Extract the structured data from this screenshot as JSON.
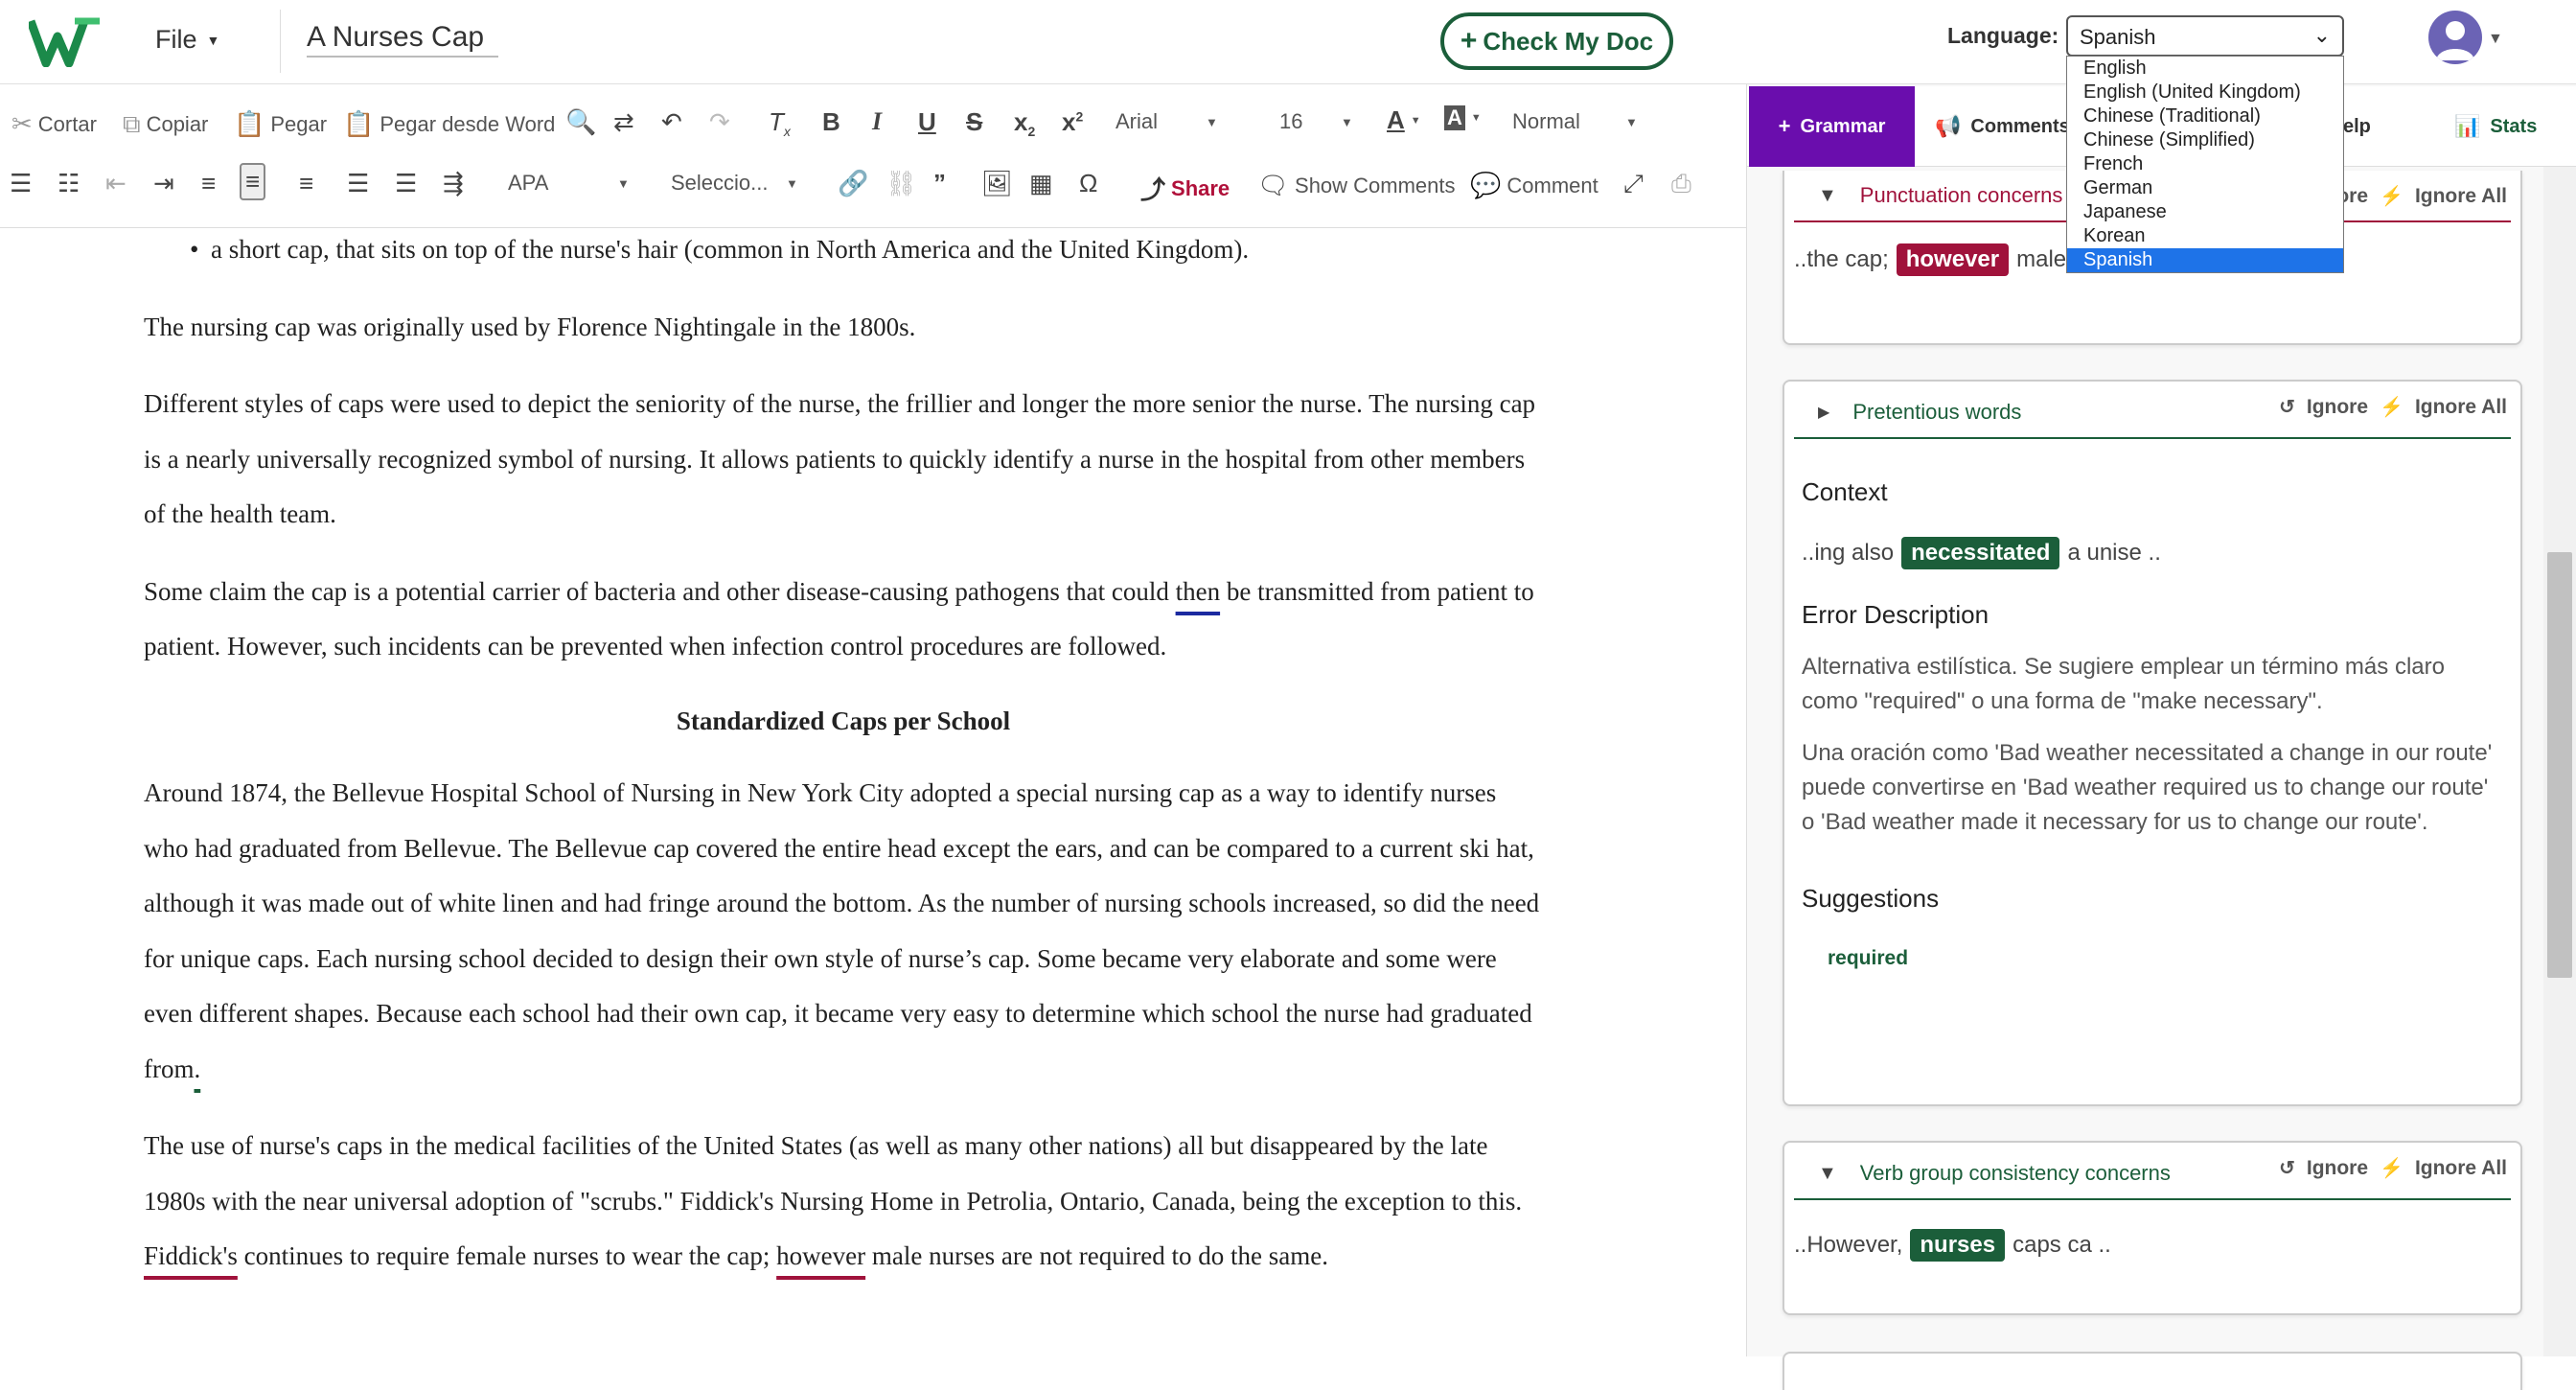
{
  "app": {
    "file_menu": "File",
    "doc_title": "A Nurses Cap",
    "check_button": "Check My Doc",
    "language_label": "Language:",
    "language_selected": "Spanish",
    "language_options": [
      "English",
      "English (United Kingdom)",
      "Chinese (Traditional)",
      "Chinese (Simplified)",
      "French",
      "German",
      "Japanese",
      "Korean",
      "Spanish"
    ]
  },
  "toolbar": {
    "cut": "Cortar",
    "copy": "Copiar",
    "paste": "Pegar",
    "paste_word": "Pegar desde Word",
    "font": "Arial",
    "size": "16",
    "style": "Normal",
    "citation": "APA",
    "select": "Seleccio...",
    "share": "Share",
    "show_comments": "Show Comments",
    "comment": "Comment"
  },
  "document": {
    "bullet": "a short cap, that sits on top of the nurse's hair (common in North America and the United Kingdom).",
    "p1": "The nursing cap was originally used by Florence Nightingale in the 1800s.",
    "p2": "Different styles of caps were used to depict the seniority of the nurse, the frillier and longer the more senior the nurse. The nursing cap is a nearly universally recognized symbol of nursing. It allows patients to quickly identify a nurse in the hospital from other members of the health team.",
    "p3_a": "Some claim the cap is a potential carrier of bacteria and other disease-causing pathogens that could ",
    "p3_flag": "then",
    "p3_b": " be transmitted from patient to patient. However, such incidents can be prevented when infection control procedures are followed.",
    "heading": "Standardized Caps per School",
    "p4_a": "Around 1874, the Bellevue Hospital School of Nursing in New York City adopted a special nursing cap as a way to identify nurses who had graduated from Bellevue. The Bellevue cap covered the entire head except the ears, and can be compared to a current ski hat, although it was made out of white linen and had fringe around the bottom. As the number of nursing schools increased, so did the need for unique caps. Each nursing school decided to design their own style of nurse’s cap. Some became very elaborate and some were even different shapes. Because each school had their own cap, it became very easy to determine which school the nurse had graduated from",
    "p4_flag": ".",
    "p5_a": "The use of nurse's caps in the medical facilities of the United States (as well as many other nations) all but disappeared by the late 1980s with the near universal adoption of \"scrubs.\" Fiddick's Nursing Home in Petrolia, Ontario, Canada, being the exception to this. ",
    "p5_flag1": "Fiddick's",
    "p5_b": " continues to require female nurses to wear the cap; ",
    "p5_flag2": "however",
    "p5_c": " male nurses are not required to do the same."
  },
  "sidebar": {
    "tab_grammar": "Grammar",
    "tab_comments": "Comments",
    "tab_help": "elp",
    "tab_stats": "Stats",
    "ignore": "Ignore",
    "ignore_all": "Ignore All",
    "card1": {
      "title": "Punctuation concerns",
      "ignore_partial": "ore",
      "ctx_before": "..the cap;",
      "ctx_word": "however",
      "ctx_after": "male nu ..",
      "color": "#a0123b"
    },
    "card2": {
      "title": "Pretentious words",
      "context_label": "Context",
      "ctx_before": "..ing also",
      "ctx_word": "necessitated",
      "ctx_after": "a unise ..",
      "error_label": "Error Description",
      "desc1": "Alternativa estilística. Se sugiere emplear un término más claro como \"required\" o una forma de \"make necessary\".",
      "desc2": "Una oración como 'Bad weather necessitated a change in our route' puede convertirse en 'Bad weather required us to change our route' o 'Bad weather made it necessary for us to change our route'.",
      "suggestions_label": "Suggestions",
      "suggestion": "required",
      "color": "#1b5e3a"
    },
    "card3": {
      "title": "Verb group consistency concerns",
      "ctx_before": "..However,",
      "ctx_word": "nurses",
      "ctx_after": "caps ca ..",
      "color": "#1b5e3a"
    }
  }
}
